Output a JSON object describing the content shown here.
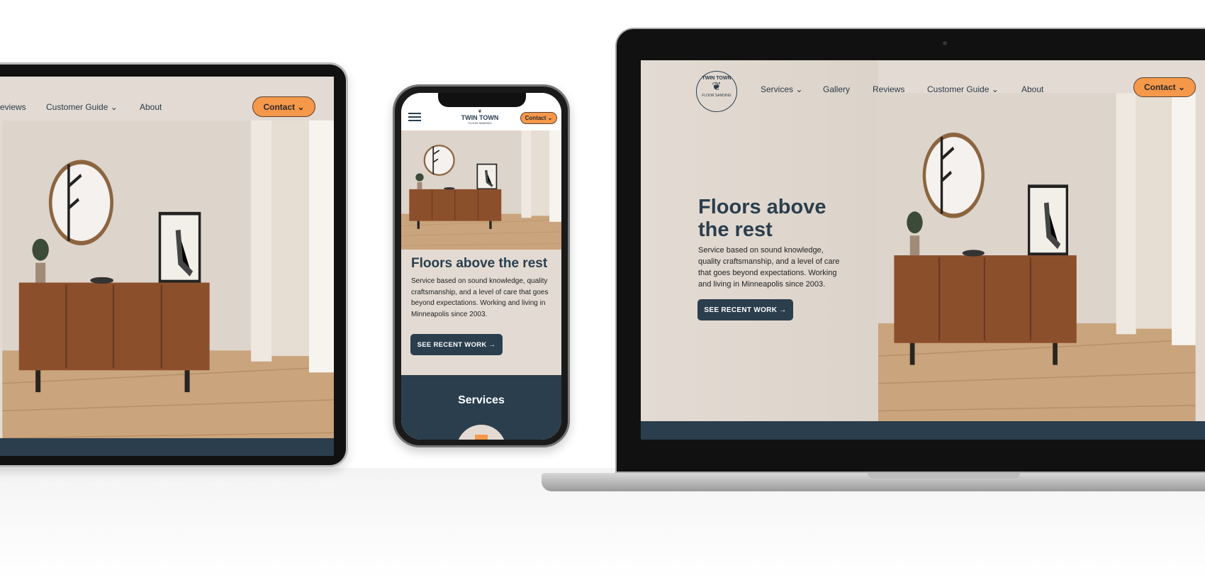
{
  "site": {
    "logo_top": "TWIN TOWN",
    "logo_bottom": "FLOOR SANDING",
    "nav": [
      "Services",
      "Gallery",
      "Reviews",
      "Customer Guide",
      "About"
    ],
    "contact_label": "Contact",
    "hero_title": "Floors above the rest",
    "hero_title_line1": "Floors above",
    "hero_title_line2": "the rest",
    "hero_text": "Service based on sound knowledge, quality craftsmanship, and a level of care that goes beyond expectations. Working and living in Minneapolis since 2003.",
    "cta_label": "SEE RECENT WORK →",
    "services_heading": "Services"
  },
  "tablet": {
    "nav_partial": "eviews",
    "nav_guide": "Customer Guide",
    "nav_about": "About"
  },
  "colors": {
    "brand_dark": "#2b3e4d",
    "accent": "#f6984a",
    "hero_bg": "#e3dbd3"
  },
  "icons": [
    "chevron-down-icon",
    "hamburger-menu-icon",
    "leaf-logo-icon",
    "arrow-right-icon"
  ]
}
